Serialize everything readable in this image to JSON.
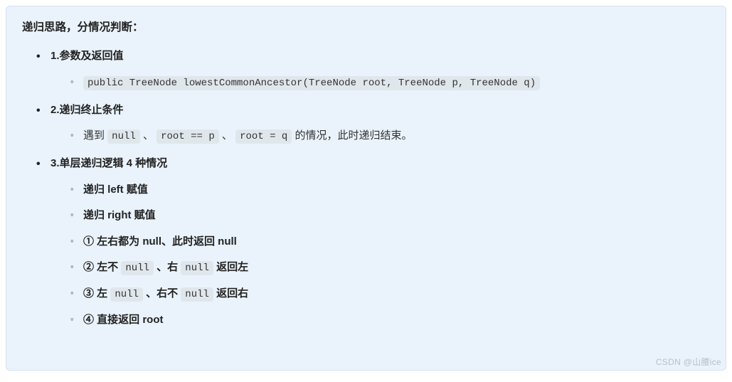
{
  "heading": "递归思路，分情况判断：",
  "items": [
    {
      "title": "1.参数及返回值",
      "children": [
        {
          "kind": "code",
          "code": "public TreeNode lowestCommonAncestor(TreeNode root, TreeNode p, TreeNode q)"
        }
      ]
    },
    {
      "title": "2.递归终止条件",
      "children": [
        {
          "kind": "mixed",
          "segments": [
            {
              "t": "text",
              "v": "遇到 "
            },
            {
              "t": "code",
              "v": "null"
            },
            {
              "t": "text",
              "v": " 、 "
            },
            {
              "t": "code",
              "v": "root == p"
            },
            {
              "t": "text",
              "v": " 、"
            },
            {
              "t": "code",
              "v": "root = q"
            },
            {
              "t": "text",
              "v": " 的情况，此时递归结束。"
            }
          ]
        }
      ]
    },
    {
      "title": "3.单层递归逻辑 4 种情况",
      "children": [
        {
          "kind": "boldtext",
          "text": "递归 left 赋值"
        },
        {
          "kind": "boldtext",
          "text": "递归 right 赋值"
        },
        {
          "kind": "boldtext",
          "text": "① 左右都为 null、此时返回 null"
        },
        {
          "kind": "boldmixed",
          "segments": [
            {
              "t": "text",
              "v": "② 左不 "
            },
            {
              "t": "code",
              "v": "null"
            },
            {
              "t": "text",
              "v": " 、右 "
            },
            {
              "t": "code",
              "v": "null"
            },
            {
              "t": "text",
              "v": " 返回左"
            }
          ]
        },
        {
          "kind": "boldmixed",
          "segments": [
            {
              "t": "text",
              "v": "③ 左 "
            },
            {
              "t": "code",
              "v": "null"
            },
            {
              "t": "text",
              "v": " 、右不 "
            },
            {
              "t": "code",
              "v": "null"
            },
            {
              "t": "text",
              "v": " 返回右"
            }
          ]
        },
        {
          "kind": "boldtext",
          "text": "④ 直接返回 root"
        }
      ]
    }
  ],
  "watermark": "CSDN @山腰ice"
}
